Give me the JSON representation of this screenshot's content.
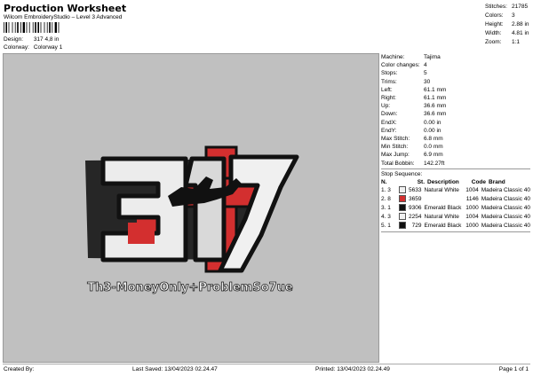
{
  "header": {
    "title": "Production Worksheet",
    "subtitle": "Wilcom EmbroideryStudio – Level 3 Advanced",
    "barcode_text": "",
    "design_label": "Design:",
    "design_value": "317 4,8 in",
    "colorway_label": "Colorway:",
    "colorway_value": "Colorway 1"
  },
  "stats": [
    {
      "label": "Stitches:",
      "value": "21785"
    },
    {
      "label": "Colors:",
      "value": "3"
    },
    {
      "label": "Height:",
      "value": "2.88 in"
    },
    {
      "label": "Width:",
      "value": "4.81 in"
    },
    {
      "label": "Zoom:",
      "value": "1:1"
    }
  ],
  "machine_info": [
    {
      "label": "Machine:",
      "value": "Tajima"
    },
    {
      "label": "Color changes:",
      "value": "4"
    },
    {
      "label": "Stops:",
      "value": "5"
    },
    {
      "label": "Trims:",
      "value": "30"
    },
    {
      "label": "Left:",
      "value": "61.1 mm"
    },
    {
      "label": "Right:",
      "value": "61.1 mm"
    },
    {
      "label": "Up:",
      "value": "36.6 mm"
    },
    {
      "label": "Down:",
      "value": "36.6 mm"
    },
    {
      "label": "EndX:",
      "value": "0.00 in"
    },
    {
      "label": "EndY:",
      "value": "0.00 in"
    },
    {
      "label": "Max Stitch:",
      "value": "6.8 mm"
    },
    {
      "label": "Min Stitch:",
      "value": "0.0 mm"
    },
    {
      "label": "Max Jump:",
      "value": "6.9 mm"
    },
    {
      "label": "Total Bobbin:",
      "value": "142.27ft"
    }
  ],
  "stop_sequence": {
    "title": "Stop Sequence:",
    "headers": {
      "n": "N.",
      "st": "St.",
      "desc": "Description",
      "code": "Code",
      "brand": "Brand"
    },
    "rows": [
      {
        "idx": "1.",
        "n": "3",
        "color": "#f0f0f0",
        "st": "5633",
        "desc": "Natural White",
        "code": "1004",
        "brand": "Madeira Classic 40"
      },
      {
        "idx": "2.",
        "n": "8",
        "color": "#d32f2f",
        "st": "3659",
        "desc": "",
        "code": "1146",
        "brand": "Madeira Classic 40"
      },
      {
        "idx": "3.",
        "n": "1",
        "color": "#111111",
        "st": "9306",
        "desc": "Emerald Black",
        "code": "1000",
        "brand": "Madeira Classic 40"
      },
      {
        "idx": "4.",
        "n": "3",
        "color": "#f0f0f0",
        "st": "2254",
        "desc": "Natural White",
        "code": "1004",
        "brand": "Madeira Classic 40"
      },
      {
        "idx": "5.",
        "n": "1",
        "color": "#111111",
        "st": "729",
        "desc": "Emerald Black",
        "code": "1000",
        "brand": "Madeira Classic 40"
      }
    ]
  },
  "design": {
    "text": "317",
    "slogan": "Th3-MoneyOnly+ProblemSo7ue"
  },
  "footer": {
    "created_by": "Created By:",
    "last_saved": "Last Saved: 13/04/2023 02.24.47",
    "printed": "Printed: 13/04/2023 02.24.49",
    "page": "Page 1 of 1"
  },
  "colors": {
    "canvas": "#c0c0c0",
    "red": "#d32f2f",
    "white": "#f0f0f0",
    "black": "#111111"
  }
}
